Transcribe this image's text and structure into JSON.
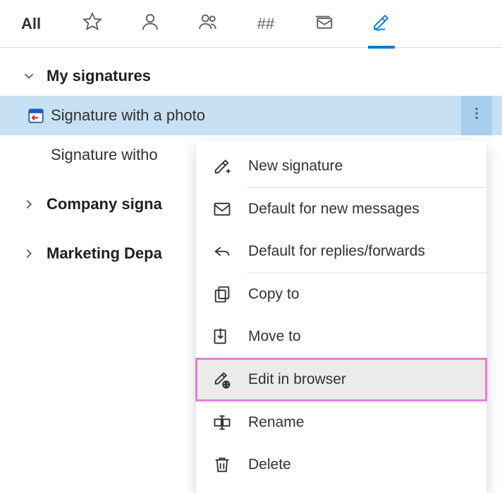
{
  "toolbar": {
    "all_label": "All",
    "hash_label": "##"
  },
  "sections": [
    {
      "label": "My signatures",
      "expanded": true
    },
    {
      "label": "Company signa",
      "expanded": false
    },
    {
      "label": "Marketing Depa",
      "expanded": false
    }
  ],
  "rows": [
    {
      "label": "Signature with a photo",
      "selected": true
    },
    {
      "label": "Signature witho",
      "selected": false
    }
  ],
  "menu": {
    "new_signature": "New signature",
    "default_new": "Default for new messages",
    "default_reply": "Default for replies/forwards",
    "copy_to": "Copy to",
    "move_to": "Move to",
    "edit_browser": "Edit in browser",
    "rename": "Rename",
    "delete": "Delete"
  }
}
